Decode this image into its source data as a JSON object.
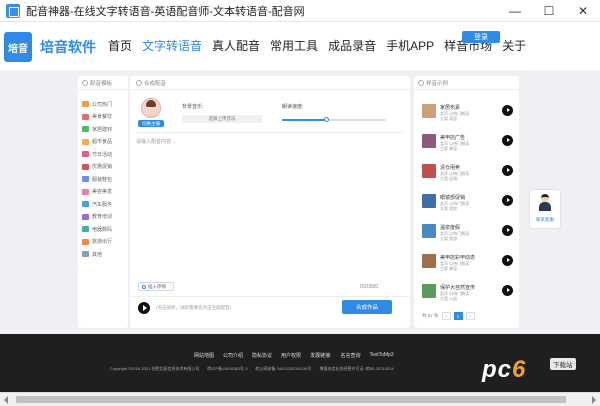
{
  "window": {
    "title": "配音神器-在线文字转语音-英语配音师-文本转语音-配音网",
    "minimize": "—",
    "maximize": "☐",
    "close": "✕"
  },
  "header": {
    "logo_mark": "培音",
    "logo_text": "培音软件",
    "login_label": "登录",
    "nav": [
      {
        "label": "首页"
      },
      {
        "label": "文字转语音",
        "active": true
      },
      {
        "label": "真人配音"
      },
      {
        "label": "常用工具"
      },
      {
        "label": "成品录音"
      },
      {
        "label": "手机APP"
      },
      {
        "label": "样音市场"
      },
      {
        "label": "关于"
      }
    ]
  },
  "left_panel": {
    "title": "配音模板",
    "items": [
      {
        "label": "公司热门",
        "color": "#f29b4b"
      },
      {
        "label": "美食餐饮",
        "color": "#e86a6a"
      },
      {
        "label": "家居建材",
        "color": "#52b86a"
      },
      {
        "label": "超市食品",
        "color": "#f0b23c"
      },
      {
        "label": "节日活动",
        "color": "#e45a8c"
      },
      {
        "label": "优惠促销",
        "color": "#d9534f"
      },
      {
        "label": "服装鞋包",
        "color": "#6a8ee8"
      },
      {
        "label": "美容美发",
        "color": "#ee7aa8"
      },
      {
        "label": "汽车服务",
        "color": "#4aa3df"
      },
      {
        "label": "教育培训",
        "color": "#9b6ad6"
      },
      {
        "label": "电器数码",
        "color": "#3cb3a5"
      },
      {
        "label": "旅游出行",
        "color": "#f08a4b"
      },
      {
        "label": "其他",
        "color": "#8aa0b8"
      }
    ]
  },
  "center_panel": {
    "title": "合成配音",
    "voice_badge": "切换主播",
    "bgm_label": "背景音乐:",
    "bgm_button": "选择上传音乐",
    "speed_label": "朗读速度:",
    "speed_value": 0.42,
    "text_placeholder": "请输入配音内容...",
    "insert_pause": "插入停顿",
    "char_count": "0/20000",
    "play_hint": "(点击试听，试听需要先点击合成配音)",
    "synth_button": "合成作品"
  },
  "right_panel": {
    "title": "样音示例",
    "samples": [
      {
        "title": "家居布素",
        "sub": "女声 以待门朗读",
        "sub2": "方案 家居",
        "color": "#c9a27a"
      },
      {
        "title": "美甲店广告",
        "sub": "女声 以待门朗读",
        "sub2": "方案 美容",
        "color": "#8c5a7a"
      },
      {
        "title": "清仓甩卖",
        "sub": "女声 以待门朗读",
        "sub2": "方案 促销",
        "color": "#c05050"
      },
      {
        "title": "眼镜部促销",
        "sub": "女声 以待门朗读",
        "sub2": "方案 其他",
        "color": "#3f6ea8"
      },
      {
        "title": "温泉度假",
        "sub": "女声 以待门朗读",
        "sub2": "方案 旅游",
        "color": "#4a8ac0"
      },
      {
        "title": "美甲店彩甲动态",
        "sub": "女声 以待门朗读",
        "sub2": "方案 美容",
        "color": "#a0704a"
      },
      {
        "title": "保护大自然宣传",
        "sub": "女声 以待门朗读",
        "sub2": "方案 公益",
        "color": "#5a9a5a"
      }
    ],
    "pager": {
      "total": "共 37 条",
      "prev": "‹",
      "current": "1",
      "next": "›"
    }
  },
  "contact": {
    "label": "联系客服"
  },
  "footer": {
    "links": [
      "网站地图",
      "公司介绍",
      "隐私协议",
      "用户权限",
      "发展链接:",
      "名言查询",
      "TextToMp3"
    ],
    "copy": [
      "Copyright ©2016-2021 合肥北辰信息技术有限公司",
      "皖ICP备18016383号-3",
      "皖公网安备 34010202001155号",
      "增值电信业务经营许可证: 皖B2-20210204"
    ]
  },
  "watermark": {
    "logo_main": "pc",
    "logo_six": "6",
    "tag": "下载站"
  }
}
